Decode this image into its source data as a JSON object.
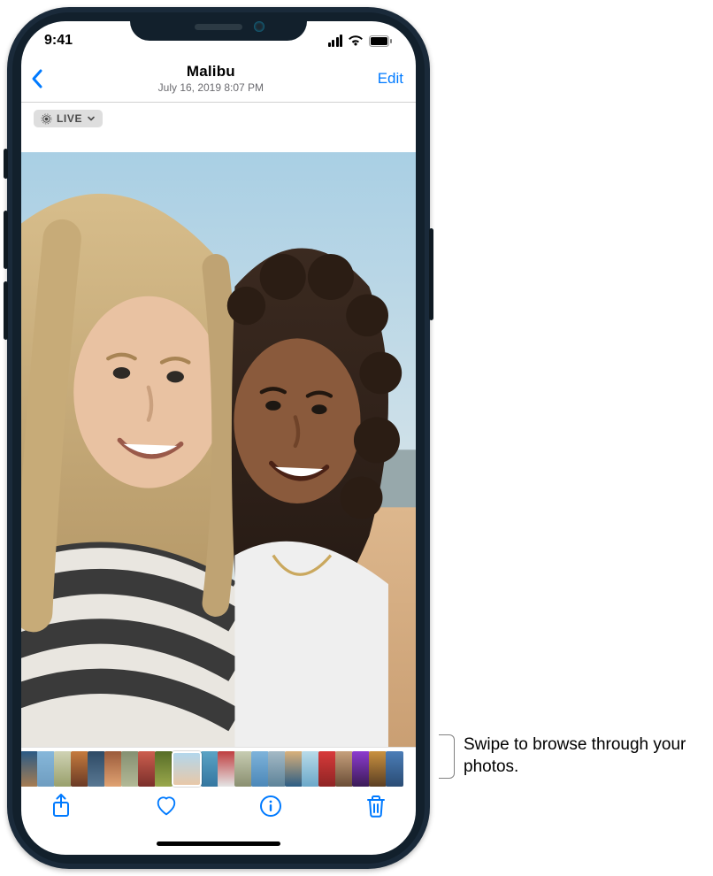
{
  "status": {
    "time": "9:41"
  },
  "nav": {
    "title": "Malibu",
    "subtitle": "July 16, 2019  8:07 PM",
    "edit_label": "Edit"
  },
  "live_badge": {
    "label": "LIVE"
  },
  "thumbnails": [
    {
      "bg": "linear-gradient(#2a5a85,#a67c52)",
      "current": false
    },
    {
      "bg": "linear-gradient(#86b7da,#6f9dc0)",
      "current": false
    },
    {
      "bg": "linear-gradient(#cfd2b4,#99a06b)",
      "current": false
    },
    {
      "bg": "linear-gradient(#c57b3e,#6a3a25)",
      "current": false
    },
    {
      "bg": "linear-gradient(#2e4a65,#597893)",
      "current": false
    },
    {
      "bg": "linear-gradient(#9b5b3b,#e0a272)",
      "current": false
    },
    {
      "bg": "linear-gradient(#859072,#b3b996)",
      "current": false
    },
    {
      "bg": "linear-gradient(#cc5e4e,#7b2f2b)",
      "current": false
    },
    {
      "bg": "linear-gradient(#576d27,#9aa84c)",
      "current": false
    },
    {
      "bg": "linear-gradient(#b3d7ec,#e8c8a8)",
      "current": true
    },
    {
      "bg": "linear-gradient(#5aa3c5,#3476a0)",
      "current": false
    },
    {
      "bg": "linear-gradient(#bf3e40,#e4e4e4)",
      "current": false
    },
    {
      "bg": "linear-gradient(#c7ccb2,#8a8f70)",
      "current": false
    },
    {
      "bg": "linear-gradient(#7eb3da,#4b87b8)",
      "current": false
    },
    {
      "bg": "linear-gradient(#a4b9c5,#5d8399)",
      "current": false
    },
    {
      "bg": "linear-gradient(#d9b07a,#2c5d84)",
      "current": false
    },
    {
      "bg": "linear-gradient(#b9dbe9,#6ba8c9)",
      "current": false
    },
    {
      "bg": "linear-gradient(#d83a3a,#8e2424)",
      "current": false
    },
    {
      "bg": "linear-gradient(#c6a07c,#6a4d36)",
      "current": false
    },
    {
      "bg": "linear-gradient(#8d3bd0,#3a1b55)",
      "current": false
    },
    {
      "bg": "linear-gradient(#c9913f,#5a3e23)",
      "current": false
    },
    {
      "bg": "linear-gradient(#4b7db7,#2a4c74)",
      "current": false
    }
  ],
  "callout": {
    "text": "Swipe to browse through your photos."
  },
  "colors": {
    "accent": "#007aff"
  }
}
